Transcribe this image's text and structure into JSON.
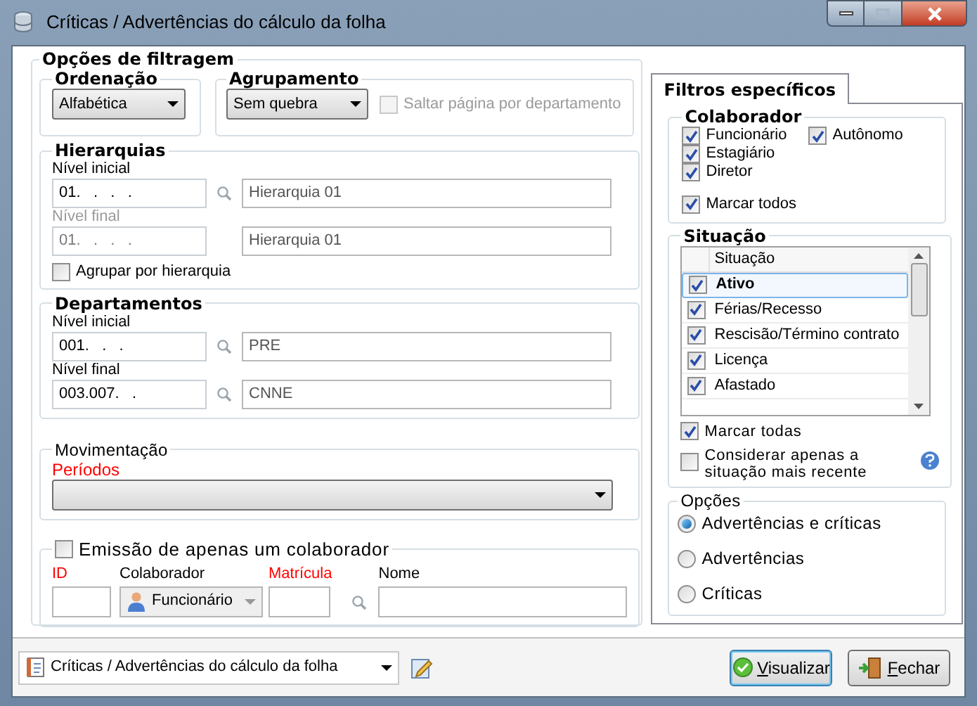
{
  "window": {
    "title": "Críticas / Advertências do cálculo da folha"
  },
  "filter_options": {
    "title": "Opções de filtragem",
    "ordenacao": {
      "title": "Ordenação",
      "value": "Alfabética"
    },
    "agrupamento": {
      "title": "Agrupamento",
      "value": "Sem quebra",
      "skip_page": {
        "label": "Saltar página por departamento",
        "checked": false,
        "disabled": true
      }
    },
    "hierarquias": {
      "title": "Hierarquias",
      "levels": [
        {
          "label": "Nível inicial",
          "code": "01.   .   .   .",
          "name": "Hierarquia 01",
          "disabled": false
        },
        {
          "label": "Nível final",
          "code": "01.   .   .   .",
          "name": "Hierarquia 01",
          "disabled": true
        }
      ],
      "group": {
        "label": "Agrupar por hierarquia",
        "checked": false
      }
    },
    "departamentos": {
      "title": "Departamentos",
      "levels": [
        {
          "label": "Nível inicial",
          "code": "001.   .   .",
          "name": "PRE",
          "disabled": false
        },
        {
          "label": "Nível final",
          "code": "003.007.   .",
          "name": "CNNE",
          "disabled": false
        }
      ]
    },
    "movimentacao": {
      "title": "Movimentação",
      "periods_label": "Períodos"
    },
    "single_employee": {
      "label": "Emissão de apenas um colaborador",
      "checked": false,
      "fields": [
        {
          "kind": "text",
          "label": "ID",
          "required": true
        },
        {
          "kind": "select",
          "label": "Colaborador",
          "required": false,
          "value": "Funcionário"
        },
        {
          "kind": "lookup",
          "label": "Matrícula",
          "required": true
        },
        {
          "kind": "text",
          "label": "Nome",
          "required": false
        }
      ]
    }
  },
  "specific_filters": {
    "tab": "Filtros específicos",
    "colaborador": {
      "title": "Colaborador",
      "options": [
        {
          "label": "Funcionário",
          "checked": true
        },
        {
          "label": "Autônomo",
          "checked": true
        },
        {
          "label": "Estagiário",
          "checked": true
        },
        {
          "label": "Diretor",
          "checked": true
        }
      ],
      "mark_all": {
        "label": "Marcar todos",
        "checked": true
      }
    },
    "situacao": {
      "title": "Situação",
      "column": "Situação",
      "rows": [
        {
          "label": "Ativo",
          "checked": true,
          "selected": true
        },
        {
          "label": "Férias/Recesso",
          "checked": true,
          "selected": false
        },
        {
          "label": "Rescisão/Término contrato",
          "checked": true,
          "selected": false
        },
        {
          "label": "Licença",
          "checked": true,
          "selected": false
        },
        {
          "label": "Afastado",
          "checked": true,
          "selected": false
        }
      ],
      "mark_all": {
        "label": "Marcar todas",
        "checked": true
      },
      "recent": {
        "label": "Considerar apenas a situação mais recente",
        "checked": false
      }
    },
    "opcoes": {
      "title": "Opções",
      "radios": [
        {
          "label": "Advertências e críticas",
          "selected": true
        },
        {
          "label": "Advertências",
          "selected": false
        },
        {
          "label": "Críticas",
          "selected": false
        }
      ]
    }
  },
  "footer": {
    "report": "Críticas / Advertências do cálculo da folha",
    "buttons": [
      {
        "kind": "primary",
        "label": "Visualizar"
      },
      {
        "kind": "close",
        "label": "Fechar"
      }
    ]
  }
}
